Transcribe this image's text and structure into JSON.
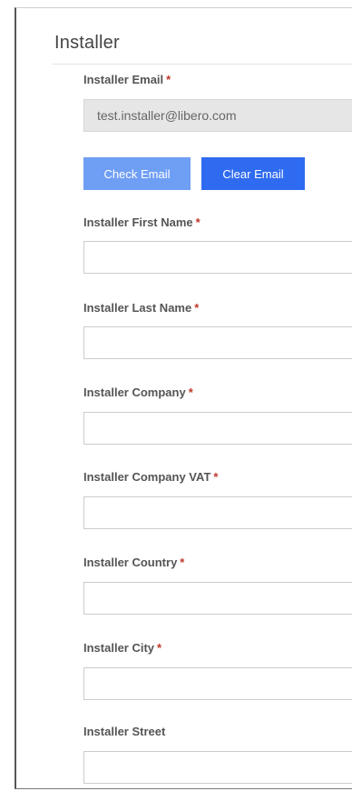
{
  "section": {
    "title": "Installer"
  },
  "email": {
    "label": "Installer Email",
    "required_mark": "*",
    "value": "test.installer@libero.com"
  },
  "buttons": {
    "check_email": "Check Email",
    "clear_email": "Clear Email"
  },
  "fields": [
    {
      "label": "Installer First Name",
      "required_mark": "*",
      "value": ""
    },
    {
      "label": "Installer Last Name",
      "required_mark": "*",
      "value": ""
    },
    {
      "label": "Installer Company",
      "required_mark": "*",
      "value": ""
    },
    {
      "label": "Installer Company VAT",
      "required_mark": "*",
      "value": ""
    },
    {
      "label": "Installer Country",
      "required_mark": "*",
      "value": ""
    },
    {
      "label": "Installer City",
      "required_mark": "*",
      "value": ""
    },
    {
      "label": "Installer Street",
      "required_mark": "",
      "value": ""
    }
  ],
  "colors": {
    "check_button": "#6f9ef5",
    "clear_button": "#2f6bf0",
    "required_asterisk": "#c0392b",
    "readonly_input": "#e6e6e6"
  }
}
